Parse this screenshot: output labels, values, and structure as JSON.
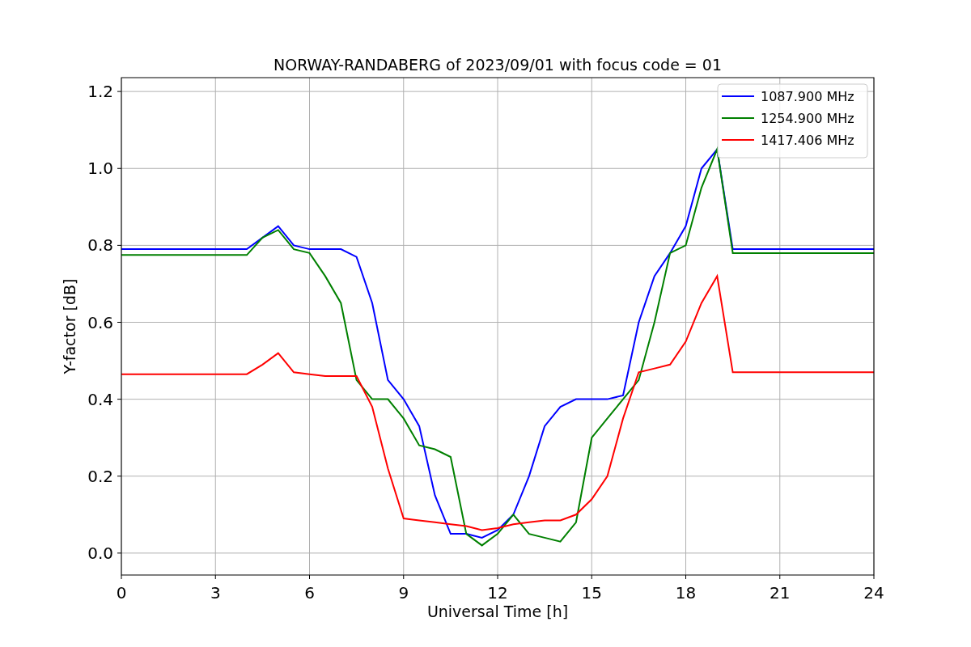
{
  "chart_data": {
    "type": "line",
    "title": "NORWAY-RANDABERG of 2023/09/01 with focus code = 01",
    "xlabel": "Universal Time [h]",
    "ylabel": "Y-factor [dB]",
    "x": [
      0,
      0.5,
      1,
      1.5,
      2,
      2.5,
      3,
      3.5,
      4,
      4.5,
      5,
      5.5,
      6,
      6.5,
      7,
      7.5,
      8,
      8.5,
      9,
      9.5,
      10,
      10.5,
      11,
      11.5,
      12,
      12.5,
      13,
      13.5,
      14,
      14.5,
      15,
      15.5,
      16,
      16.5,
      17,
      17.5,
      18,
      18.5,
      19,
      19.5,
      20,
      20.5,
      21,
      21.5,
      22,
      22.5,
      23,
      23.5,
      24
    ],
    "series": [
      {
        "name": "1087.900 MHz",
        "color": "#0000ff",
        "values": [
          0.79,
          0.79,
          0.79,
          0.79,
          0.79,
          0.79,
          0.79,
          0.79,
          0.79,
          0.82,
          0.85,
          0.8,
          0.79,
          0.79,
          0.79,
          0.77,
          0.65,
          0.45,
          0.4,
          0.33,
          0.15,
          0.05,
          0.05,
          0.04,
          0.06,
          0.1,
          0.2,
          0.33,
          0.38,
          0.4,
          0.4,
          0.4,
          0.41,
          0.6,
          0.72,
          0.78,
          0.85,
          1.0,
          1.05,
          0.79,
          0.79,
          0.79,
          0.79,
          0.79,
          0.79,
          0.79,
          0.79,
          0.79,
          0.79
        ]
      },
      {
        "name": "1254.900 MHz",
        "color": "#008000",
        "values": [
          0.775,
          0.775,
          0.775,
          0.775,
          0.775,
          0.775,
          0.775,
          0.775,
          0.775,
          0.82,
          0.84,
          0.79,
          0.78,
          0.72,
          0.65,
          0.45,
          0.4,
          0.4,
          0.35,
          0.28,
          0.27,
          0.25,
          0.05,
          0.02,
          0.05,
          0.1,
          0.05,
          0.04,
          0.03,
          0.08,
          0.3,
          0.35,
          0.4,
          0.45,
          0.6,
          0.78,
          0.8,
          0.95,
          1.05,
          0.78,
          0.78,
          0.78,
          0.78,
          0.78,
          0.78,
          0.78,
          0.78,
          0.78,
          0.78
        ]
      },
      {
        "name": "1417.406 MHz",
        "color": "#ff0000",
        "values": [
          0.465,
          0.465,
          0.465,
          0.465,
          0.465,
          0.465,
          0.465,
          0.465,
          0.465,
          0.49,
          0.52,
          0.47,
          0.465,
          0.46,
          0.46,
          0.46,
          0.38,
          0.22,
          0.09,
          0.085,
          0.08,
          0.075,
          0.07,
          0.06,
          0.065,
          0.075,
          0.08,
          0.085,
          0.085,
          0.1,
          0.14,
          0.2,
          0.35,
          0.47,
          0.48,
          0.49,
          0.55,
          0.65,
          0.72,
          0.47,
          0.47,
          0.47,
          0.47,
          0.47,
          0.47,
          0.47,
          0.47,
          0.47,
          0.47
        ]
      }
    ],
    "grid": true,
    "legend": true,
    "xlim": [
      0,
      24
    ],
    "ylim": [
      -0.057,
      1.236
    ],
    "xticks": [
      0,
      3,
      6,
      9,
      12,
      15,
      18,
      21,
      24
    ],
    "yticks": [
      {
        "value": 0,
        "label": "0.0"
      },
      {
        "value": 0.2,
        "label": "0.2"
      },
      {
        "value": 0.4,
        "label": "0.4"
      },
      {
        "value": 0.6,
        "label": "0.6"
      },
      {
        "value": 0.8,
        "label": "0.8"
      },
      {
        "value": 1.0,
        "label": "1.0"
      },
      {
        "value": 1.2,
        "label": "1.2"
      }
    ]
  }
}
